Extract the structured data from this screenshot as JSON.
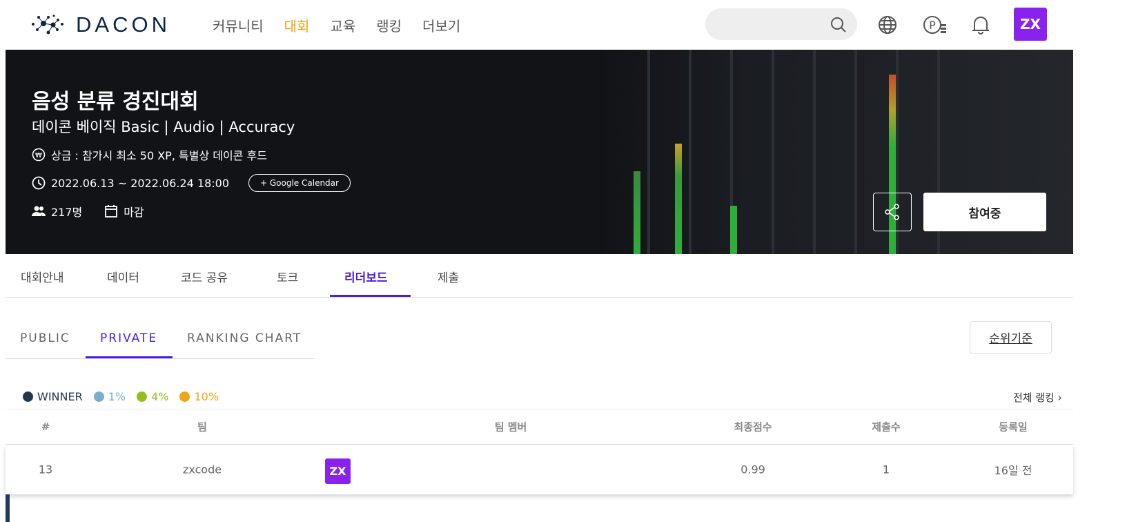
{
  "header": {
    "logo": "DACON",
    "nav": [
      {
        "label": "커뮤니티"
      },
      {
        "label": "대회",
        "active": true
      },
      {
        "label": "교육"
      },
      {
        "label": "랭킹"
      },
      {
        "label": "더보기"
      }
    ],
    "search_placeholder": "",
    "icons": [
      "search-icon",
      "globe-icon",
      "point-icon",
      "bell-icon"
    ],
    "avatar": "ZX",
    "accent": "#f5a00b"
  },
  "banner": {
    "title": "음성 분류 경진대회",
    "subtitle": "데이콘 베이직 Basic | Audio | Accuracy",
    "prize": "상금 : 참가시 최소 50 XP, 특별상 데이콘 후드",
    "period": "2022.06.13 ~ 2022.06.24 18:00",
    "calendar_button": "+ Google Calendar",
    "participants": "217명",
    "status": "마감",
    "join_button": "참여중"
  },
  "tabs": [
    {
      "label": "대회안내"
    },
    {
      "label": "데이터"
    },
    {
      "label": "코드 공유"
    },
    {
      "label": "토크"
    },
    {
      "label": "리더보드",
      "active": true
    },
    {
      "label": "제출"
    }
  ],
  "leaderboard": {
    "sub_tabs": [
      {
        "label": "PUBLIC"
      },
      {
        "label": "PRIVATE",
        "active": true
      },
      {
        "label": "RANKING CHART"
      }
    ],
    "rank_basis_button": "순위기준",
    "legend": [
      {
        "label": "WINNER",
        "color": "#233650"
      },
      {
        "label": "1%",
        "color": "#7bacd0"
      },
      {
        "label": "4%",
        "color": "#93c01f"
      },
      {
        "label": "10%",
        "color": "#f0a514"
      }
    ],
    "all_ranking_link": "전체 랭킹 ›",
    "columns": [
      "#",
      "팀",
      "팀 멤버",
      "최종점수",
      "제출수",
      "등록일"
    ],
    "rows": [
      {
        "rank": "13",
        "team": "zxcode",
        "member_avatar": "ZX",
        "score": "0.99",
        "submissions": "1",
        "registered": "16일 전"
      }
    ]
  },
  "colors": {
    "primary": "#4a1de0",
    "avatar": "#8a22ee"
  }
}
